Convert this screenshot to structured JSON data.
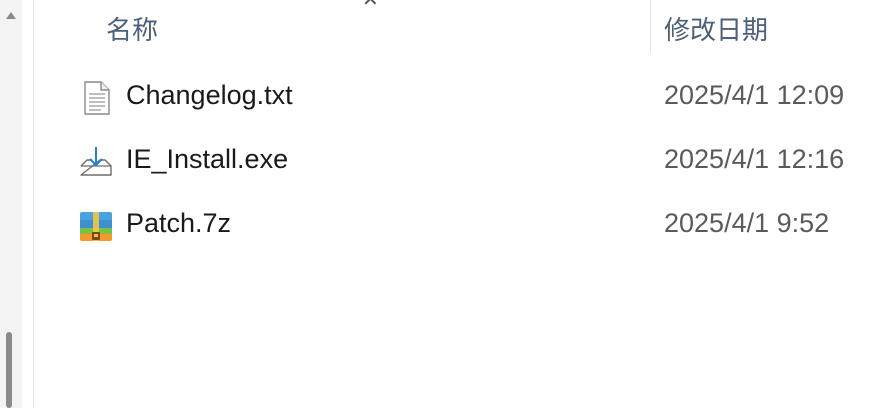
{
  "header": {
    "name_label": "名称",
    "date_label": "修改日期"
  },
  "files": [
    {
      "name": "Changelog.txt",
      "date": "2025/4/1 12:09",
      "icon": "text-file-icon"
    },
    {
      "name": "IE_Install.exe",
      "date": "2025/4/1 12:16",
      "icon": "installer-icon"
    },
    {
      "name": "Patch.7z",
      "date": "2025/4/1 9:52",
      "icon": "archive-icon"
    }
  ],
  "colors": {
    "header_text": "#4c607a",
    "file_text": "#1a1a1a",
    "date_text": "#5a5a5a"
  }
}
